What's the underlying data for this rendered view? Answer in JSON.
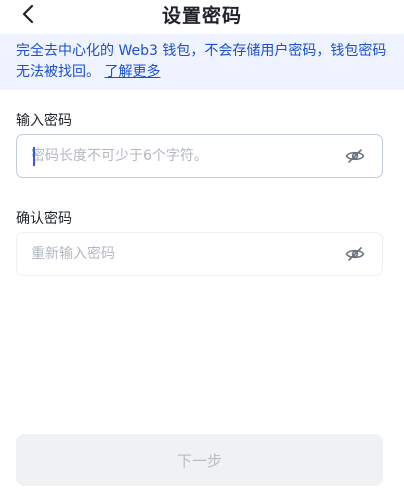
{
  "header": {
    "title": "设置密码",
    "back_icon": "chevron-left-icon"
  },
  "notice": {
    "text": "完全去中心化的 Web3 钱包，不会存储用户密码，钱包密码无法被找回。",
    "link": "了解更多"
  },
  "password_field": {
    "label": "输入密码",
    "value": "",
    "placeholder": "密码长度不可少于6个字符。",
    "toggle_icon": "eye-off-icon"
  },
  "confirm_field": {
    "label": "确认密码",
    "value": "",
    "placeholder": "重新输入密码",
    "toggle_icon": "eye-off-icon"
  },
  "next_button": {
    "label": "下一步"
  },
  "colors": {
    "accent": "#1a4fd6",
    "notice_bg": "#eef3ff",
    "disabled_bg": "#f0f1f3"
  }
}
